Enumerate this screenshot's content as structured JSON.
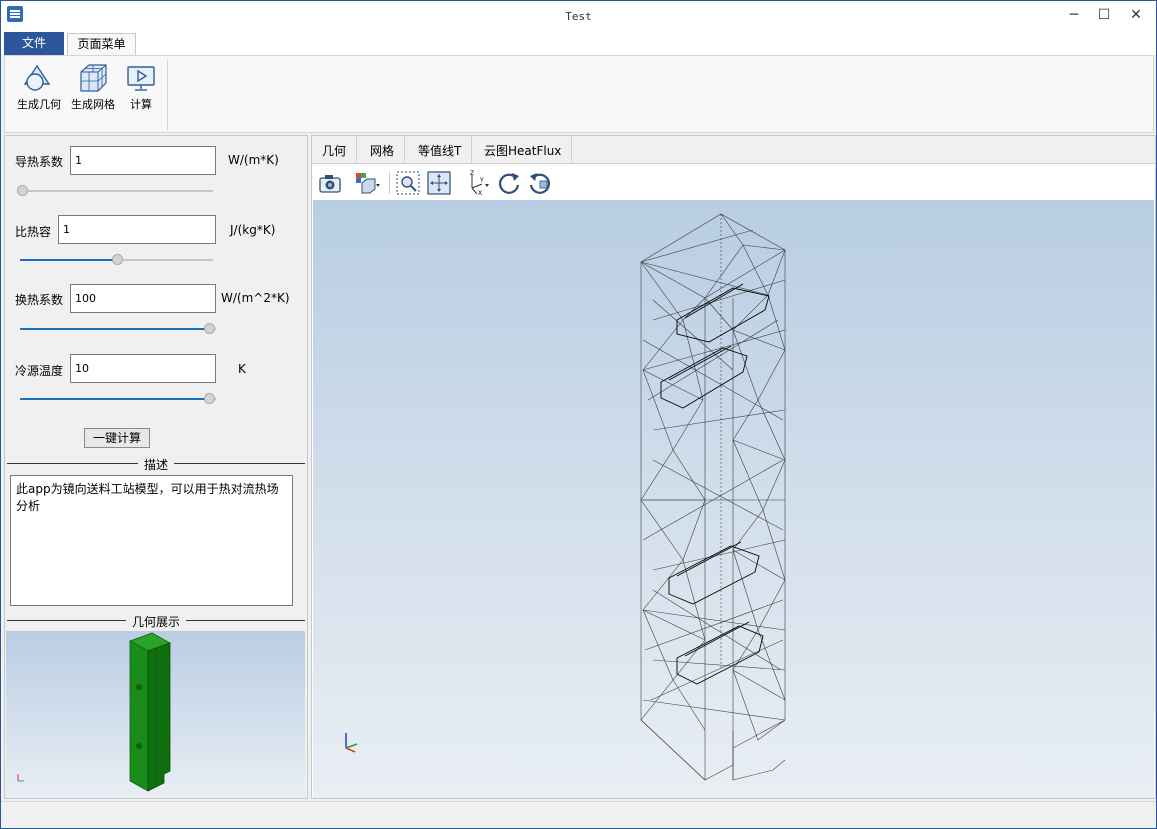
{
  "window": {
    "title": "Test",
    "controls": {
      "minimize": "─",
      "maximize": "☐",
      "close": "✕"
    }
  },
  "ribbon": {
    "tabs": {
      "file": "文件",
      "page_menu": "页面菜单"
    },
    "buttons": [
      {
        "label": "生成几何",
        "icon": "geometry-icon"
      },
      {
        "label": "生成网格",
        "icon": "mesh-icon"
      },
      {
        "label": "计算",
        "icon": "compute-icon"
      }
    ]
  },
  "params": {
    "conductivity": {
      "label": "导热系数",
      "value": "1",
      "unit": "W/(m*K)",
      "slider": 0
    },
    "specific_heat": {
      "label": "比热容",
      "value": "1",
      "unit": "J/(kg*K)",
      "slider": 0.5
    },
    "heat_transfer": {
      "label": "换热系数",
      "value": "100",
      "unit": "W/(m^2*K)",
      "slider": 1.0
    },
    "cold_temp": {
      "label": "冷源温度",
      "value": "10",
      "unit": "K",
      "slider": 1.0
    }
  },
  "calc_button": "一键计算",
  "description": {
    "title": "描述",
    "text": "此app为镜向送料工站模型，可以用于热对流热场分析"
  },
  "geometry_display": {
    "title": "几何展示"
  },
  "view": {
    "tabs": [
      "几何",
      "网格",
      "等值线T",
      "云图HeatFlux"
    ],
    "toolbar": [
      "camera-icon",
      "view-box-icon",
      "zoom-box-icon",
      "fit-view-icon",
      "axes-icon",
      "rotate-cw-icon",
      "rotate-ccw-icon"
    ]
  },
  "colors": {
    "accent": "#2b579a",
    "slider": "#1f6fb8",
    "model_green": "#1a8c1a",
    "mesh_line": "#222222"
  }
}
